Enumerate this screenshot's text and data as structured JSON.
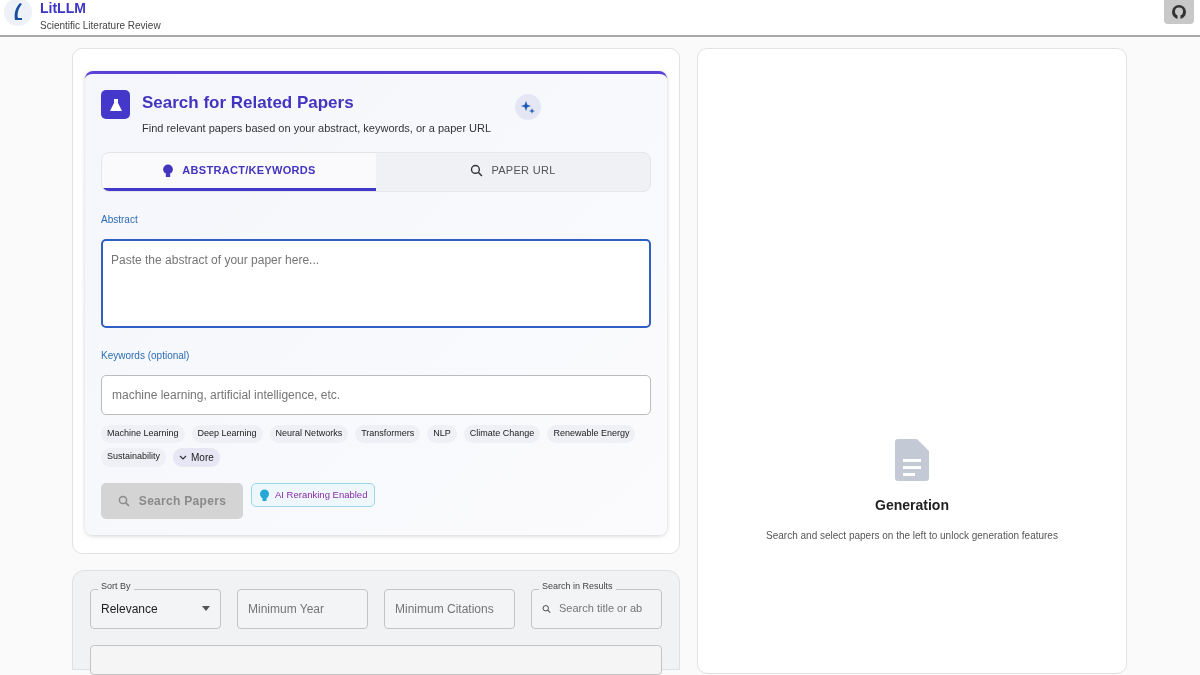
{
  "header": {
    "title": "LitLLM",
    "subtitle": "Scientific Literature Review"
  },
  "search_card": {
    "title": "Search for Related Papers",
    "subtitle": "Find relevant papers based on your abstract, keywords, or a paper URL",
    "tabs": [
      {
        "label": "ABSTRACT/KEYWORDS",
        "selected": true
      },
      {
        "label": "PAPER URL",
        "selected": false
      }
    ],
    "abstract": {
      "label": "Abstract",
      "placeholder": "Paste the abstract of your paper here..."
    },
    "keywords": {
      "label": "Keywords (optional)",
      "placeholder": "machine learning, artificial intelligence, etc."
    },
    "chips": [
      "Machine Learning",
      "Deep Learning",
      "Neural Networks",
      "Transformers",
      "NLP",
      "Climate Change",
      "Renewable Energy",
      "Sustainability"
    ],
    "more_button": "More",
    "search_button": {
      "label": "Search Papers",
      "disabled": true
    },
    "rerank_badge": "AI Reranking Enabled"
  },
  "filters": {
    "sort": {
      "label": "Sort By",
      "value": "Relevance"
    },
    "min_year": {
      "placeholder": "Minimum Year"
    },
    "min_citations": {
      "placeholder": "Minimum Citations"
    },
    "search": {
      "label": "Search in Results",
      "placeholder": "Search title or ab"
    }
  },
  "generation": {
    "title": "Generation",
    "message": "Search and select papers on the left to unlock generation features"
  }
}
